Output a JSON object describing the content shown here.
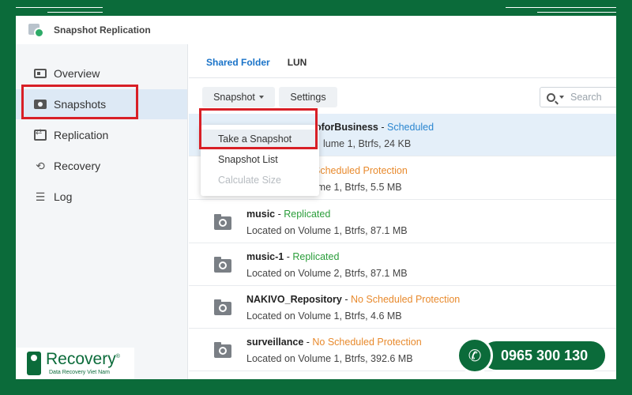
{
  "window": {
    "title": "Snapshot Replication"
  },
  "sidebar": {
    "items": [
      {
        "label": "Overview",
        "icon": "overview-icon"
      },
      {
        "label": "Snapshots",
        "icon": "camera-icon"
      },
      {
        "label": "Replication",
        "icon": "replication-icon"
      },
      {
        "label": "Recovery",
        "icon": "recovery-icon"
      },
      {
        "label": "Log",
        "icon": "list-icon"
      }
    ],
    "active": "Snapshots"
  },
  "tabs": [
    {
      "label": "Shared Folder"
    },
    {
      "label": "LUN"
    }
  ],
  "toolbar": {
    "snapshot_label": "Snapshot",
    "settings_label": "Settings",
    "search_placeholder": "Search"
  },
  "dropdown": {
    "items": [
      "Take a Snapshot",
      "Snapshot List",
      "Calculate Size"
    ]
  },
  "rows": [
    {
      "name": "oforBusiness",
      "status": "Scheduled",
      "status_color": "#2a86d0",
      "location": "lume 1, Btrfs, 24 KB"
    },
    {
      "name": "",
      "status": "Scheduled Protection",
      "status_color": "#e88a2d",
      "location": "Located on Volume 1, Btrfs, 5.5 MB"
    },
    {
      "name": "music",
      "status": "Replicated",
      "status_color": "#2a9d3a",
      "location": "Located on Volume 1, Btrfs, 87.1 MB"
    },
    {
      "name": "music-1",
      "status": "Replicated",
      "status_color": "#2a9d3a",
      "location": "Located on Volume 2, Btrfs, 87.1 MB"
    },
    {
      "name": "NAKIVO_Repository",
      "status": "No Scheduled Protection",
      "status_color": "#e88a2d",
      "location": "Located on Volume 1, Btrfs, 4.6 MB"
    },
    {
      "name": "surveillance",
      "status": "No Scheduled Protection",
      "status_color": "#e88a2d",
      "location": "Located on Volume 1, Btrfs, 392.6 MB"
    }
  ],
  "branding": {
    "logo_text": "Recovery",
    "logo_sub": "Data Recovery Viet Nam",
    "logo_symbol": "®",
    "phone": "0965 300 130",
    "accent": "#0b6b3a",
    "highlight": "#d81f26"
  },
  "separator": " - "
}
